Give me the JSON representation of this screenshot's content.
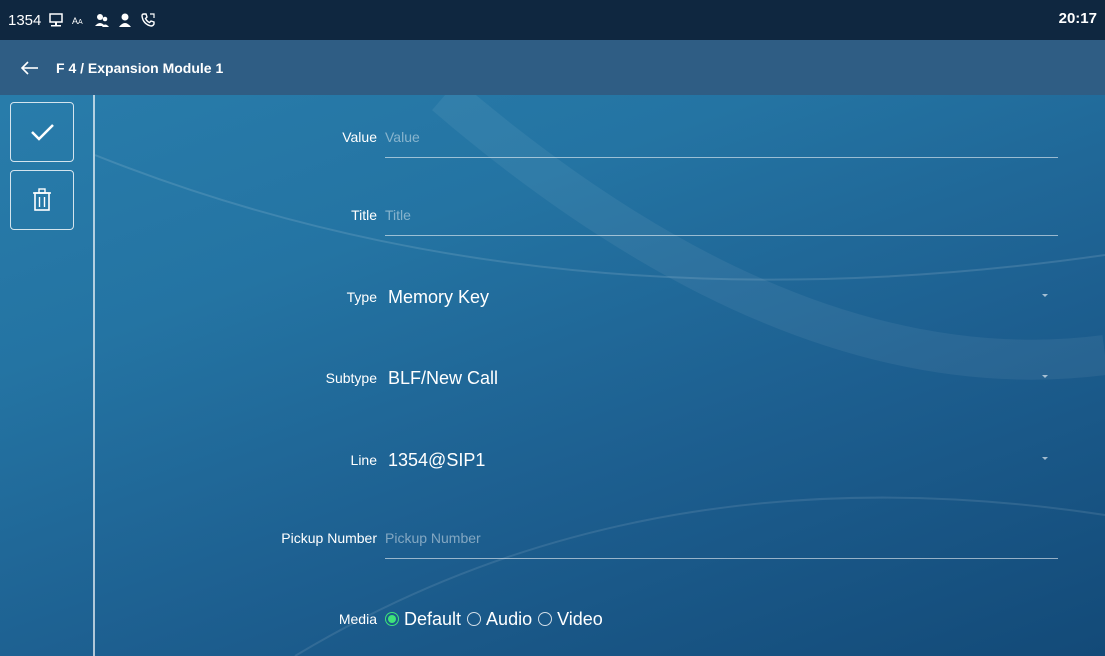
{
  "status_bar": {
    "extension": "1354",
    "time": "20:17",
    "icons": [
      "network-icon",
      "font-icon",
      "contacts-icon",
      "user-icon",
      "call-forward-icon"
    ]
  },
  "header": {
    "title": "F 4 / Expansion Module 1",
    "back_icon": "back-arrow-icon"
  },
  "sidebar": {
    "save_icon": "checkmark-icon",
    "delete_icon": "trash-icon"
  },
  "form": {
    "value": {
      "label": "Value",
      "value": "",
      "placeholder": "Value"
    },
    "title": {
      "label": "Title",
      "value": "",
      "placeholder": "Title"
    },
    "type": {
      "label": "Type",
      "value": "Memory Key"
    },
    "subtype": {
      "label": "Subtype",
      "value": "BLF/New Call"
    },
    "line": {
      "label": "Line",
      "value": "1354@SIP1"
    },
    "pickup_number": {
      "label": "Pickup Number",
      "value": "",
      "placeholder": "Pickup Number"
    },
    "media": {
      "label": "Media",
      "options": [
        "Default",
        "Audio",
        "Video"
      ],
      "selected": "Default"
    }
  },
  "colors": {
    "status_bar_bg": "#0f2740",
    "title_bar_bg": "#2f5d84",
    "radio_selected": "#3ee37a"
  }
}
